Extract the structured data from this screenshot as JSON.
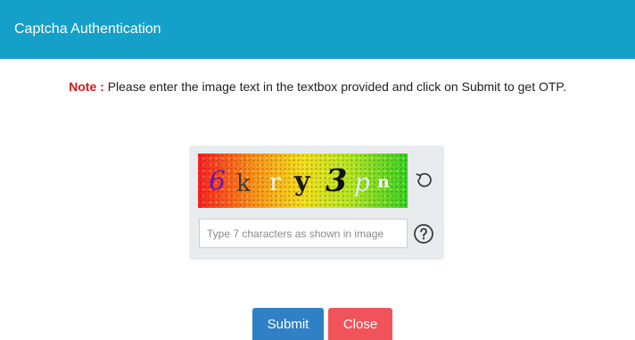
{
  "header": {
    "title": "Captcha Authentication",
    "background": "#14a0c8"
  },
  "note": {
    "label": "Note :",
    "text": " Please enter the image text in the textbox provided and click on Submit to get OTP.",
    "label_color": "#e0151b"
  },
  "captcha": {
    "image_text": "6kry3pn",
    "characters": [
      {
        "char": "6",
        "color": "#6a1aa8"
      },
      {
        "char": "k",
        "color": "#3a3a3a"
      },
      {
        "char": "r",
        "color": "#f2f2f2"
      },
      {
        "char": "y",
        "color": "#1a1a1a"
      },
      {
        "char": "3",
        "color": "#111111"
      },
      {
        "char": "p",
        "color": "#e8e8e8"
      },
      {
        "char": "n",
        "color": "#ffffff"
      }
    ],
    "refresh_icon": "refresh-icon",
    "input_value": "",
    "input_placeholder": "Type 7 characters as shown in image",
    "help_icon": "help-icon"
  },
  "buttons": {
    "submit_label": "Submit",
    "close_label": "Close",
    "submit_color": "#2f80c4",
    "close_color": "#f0545a"
  }
}
